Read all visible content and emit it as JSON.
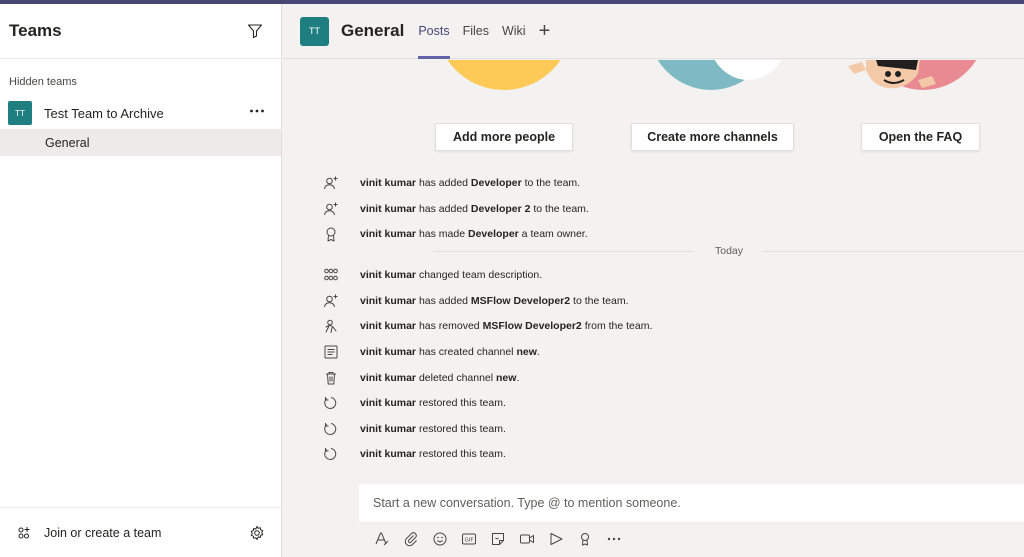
{
  "app": {
    "accent": "#464775",
    "team_color": "#1f7e80"
  },
  "sidebar": {
    "title": "Teams",
    "filter_icon": "filter-icon",
    "section_label": "Hidden teams",
    "team": {
      "avatar_initials": "TT",
      "name": "Test Team to Archive",
      "more": "•••"
    },
    "channel": {
      "name": "General"
    },
    "footer": {
      "join_label": "Join or create a team",
      "join_icon": "add-team-icon",
      "settings_icon": "gear-icon"
    }
  },
  "header": {
    "avatar_initials": "TT",
    "channel_name": "General",
    "tabs": [
      {
        "label": "Posts",
        "active": true
      },
      {
        "label": "Files",
        "active": false
      },
      {
        "label": "Wiki",
        "active": false
      }
    ],
    "add_tab": "+"
  },
  "welcome": {
    "buttons": [
      {
        "label": "Add more people"
      },
      {
        "label": "Create more channels"
      },
      {
        "label": "Open the FAQ"
      }
    ]
  },
  "activity": {
    "date_divider": "Today",
    "events_before": [
      {
        "icon": "add-person-icon",
        "actor": "vinit kumar",
        "pre": " has added ",
        "target": "Developer",
        "post": " to the team."
      },
      {
        "icon": "add-person-icon",
        "actor": "vinit kumar",
        "pre": " has added ",
        "target": "Developer 2",
        "post": " to the team."
      },
      {
        "icon": "owner-badge-icon",
        "actor": "vinit kumar",
        "pre": " has made ",
        "target": "Developer",
        "post": " a team owner."
      }
    ],
    "events_after": [
      {
        "icon": "team-description-icon",
        "actor": "vinit kumar",
        "pre": " changed team description.",
        "target": "",
        "post": ""
      },
      {
        "icon": "add-person-icon",
        "actor": "vinit kumar",
        "pre": " has added ",
        "target": "MSFlow Developer2",
        "post": " to the team."
      },
      {
        "icon": "remove-person-icon",
        "actor": "vinit kumar",
        "pre": " has removed ",
        "target": "MSFlow Developer2",
        "post": " from the team."
      },
      {
        "icon": "channel-icon",
        "actor": "vinit kumar",
        "pre": " has created channel ",
        "target": "new",
        "post": "."
      },
      {
        "icon": "trash-icon",
        "actor": "vinit kumar",
        "pre": " deleted channel ",
        "target": "new",
        "post": "."
      },
      {
        "icon": "restore-icon",
        "actor": "vinit kumar",
        "pre": " restored this team.",
        "target": "",
        "post": ""
      },
      {
        "icon": "restore-icon",
        "actor": "vinit kumar",
        "pre": " restored this team.",
        "target": "",
        "post": ""
      },
      {
        "icon": "restore-icon",
        "actor": "vinit kumar",
        "pre": " restored this team.",
        "target": "",
        "post": ""
      }
    ]
  },
  "compose": {
    "placeholder": "Start a new conversation. Type @ to mention someone.",
    "toolbar_icons": [
      "format-icon",
      "attach-icon",
      "emoji-icon",
      "gif-icon",
      "sticker-icon",
      "meet-now-icon",
      "stream-icon",
      "praise-icon",
      "more-options-icon"
    ]
  }
}
